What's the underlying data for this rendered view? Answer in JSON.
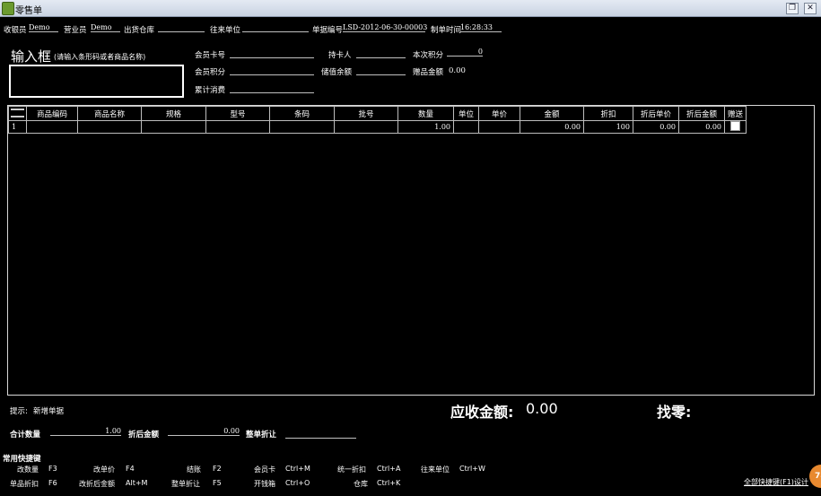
{
  "window": {
    "title": "零售单"
  },
  "header": {
    "cashier_label": "收银员",
    "cashier_value": "Demo",
    "salesperson_label": "营业员",
    "salesperson_value": "Demo",
    "warehouse_label": "出货仓库",
    "warehouse_value": "",
    "partner_label": "往来单位",
    "partner_value": "",
    "doc_no_label": "单据编号",
    "doc_no_value": "LSD-2012-06-30-00003",
    "time_label": "制单时间",
    "time_value": "16:28:33"
  },
  "input": {
    "title": "输入框",
    "hint": "(请输入条形码或者商品名称)",
    "value": ""
  },
  "member": {
    "card_label": "会员卡号",
    "card_value": "",
    "points_label": "会员积分",
    "points_value": "",
    "total_spent_label": "累计消费",
    "total_spent_value": "",
    "holder_label": "持卡人",
    "holder_value": "",
    "stored_balance_label": "储值余额",
    "stored_balance_value": "",
    "this_points_label": "本次积分",
    "this_points_value": "0",
    "gift_amount_label": "赠品金额",
    "gift_amount_value": "0.00"
  },
  "grid": {
    "columns": [
      "商品编码",
      "商品名称",
      "规格",
      "型号",
      "条码",
      "批号",
      "数量",
      "单位",
      "单价",
      "金额",
      "折扣",
      "折后单价",
      "折后金额",
      "赠送"
    ],
    "rows": [
      {
        "row_no": "1",
        "code": "",
        "name": "",
        "spec": "",
        "model": "",
        "barcode": "",
        "batch": "",
        "qty": "1.00",
        "unit": "",
        "price": "",
        "amount": "0.00",
        "discount": "100",
        "disc_price": "0.00",
        "disc_amount": "0.00",
        "gift": false
      }
    ]
  },
  "footer": {
    "hint_label": "提示:",
    "hint_value": "新增单据",
    "receivable_label": "应收金额:",
    "receivable_value": "0.00",
    "change_label": "找零:",
    "change_value": "",
    "total_qty_label": "合计数量",
    "total_qty_value": "1.00",
    "disc_amount_label": "折后金额",
    "disc_amount_value": "0.00",
    "whole_discount_label": "整单折让",
    "whole_discount_value": ""
  },
  "shortcuts": {
    "title": "常用快捷键",
    "items": [
      {
        "label": "改数量",
        "key": "F3"
      },
      {
        "label": "改单价",
        "key": "F4"
      },
      {
        "label": "结账",
        "key": "F2"
      },
      {
        "label": "会员卡",
        "key": "Ctrl+M"
      },
      {
        "label": "统一折扣",
        "key": "Ctrl+A"
      },
      {
        "label": "往来单位",
        "key": "Ctrl+W"
      },
      {
        "label": "单品折扣",
        "key": "F6"
      },
      {
        "label": "改折后金额",
        "key": "Alt+M"
      },
      {
        "label": "整单折让",
        "key": "F5"
      },
      {
        "label": "开钱箱",
        "key": "Ctrl+O"
      },
      {
        "label": "仓库",
        "key": "Ctrl+K"
      }
    ],
    "all_link": "全部快捷键(F1)设计",
    "badge": "78"
  }
}
